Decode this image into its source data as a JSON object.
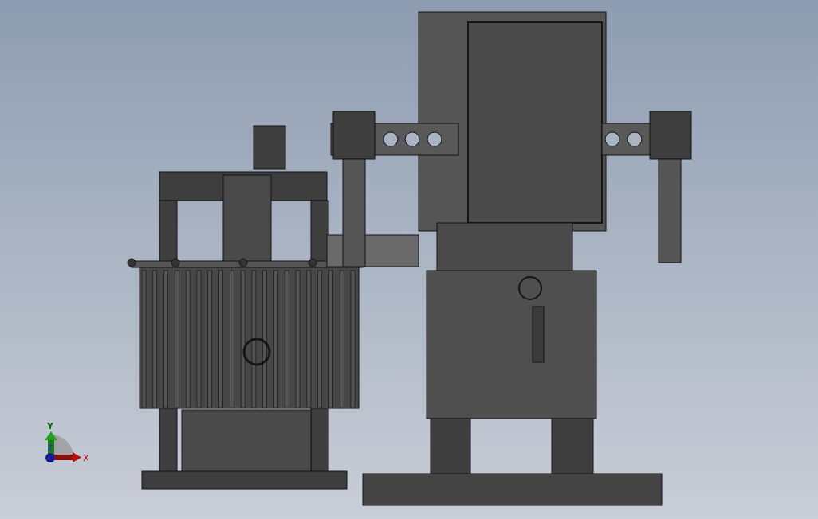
{
  "viewport": {
    "triad": {
      "y_label": "Y",
      "x_label": "X",
      "z_label": "Z"
    }
  }
}
